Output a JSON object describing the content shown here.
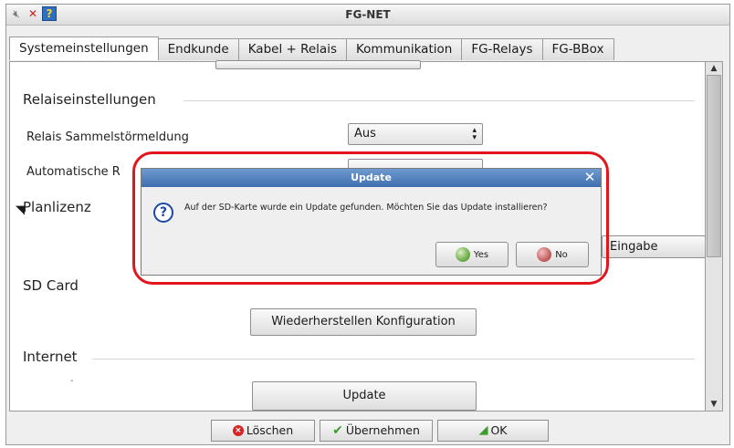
{
  "window": {
    "title": "FG-NET"
  },
  "titlebar_icons": [
    "speaker-mute-icon",
    "close-x-icon",
    "help-icon"
  ],
  "tabs": [
    {
      "label": "Systemeinstellungen",
      "active": true
    },
    {
      "label": "Endkunde"
    },
    {
      "label": "Kabel + Relais"
    },
    {
      "label": "Kommunikation"
    },
    {
      "label": "FG-Relays"
    },
    {
      "label": "FG-BBox"
    }
  ],
  "panel": {
    "relais_section": "Relaiseinstellungen",
    "sammel_label": "Relais Sammelstörmeldung",
    "sammel_value": "Aus",
    "auto_label": "Automatische R",
    "planlizenz_section": "Planlizenz",
    "eingabe_button": "Eingabe",
    "sdcard_section": "SD Card",
    "restore_button": "Wiederherstellen Konfiguration",
    "internet_section": "Internet",
    "update_button": "Update"
  },
  "bottom_bar": {
    "delete_label": "Löschen",
    "apply_label": "Übernehmen",
    "ok_label": "OK"
  },
  "dialog": {
    "title": "Update",
    "message": "Auf der SD-Karte wurde ein Update gefunden. Möchten Sie das Update installieren?",
    "yes_label": "Yes",
    "no_label": "No"
  },
  "colors": {
    "dialog_title_bg": "#4f7fc0",
    "highlight": "#e3141c",
    "panel_bg": "#ffffff"
  }
}
